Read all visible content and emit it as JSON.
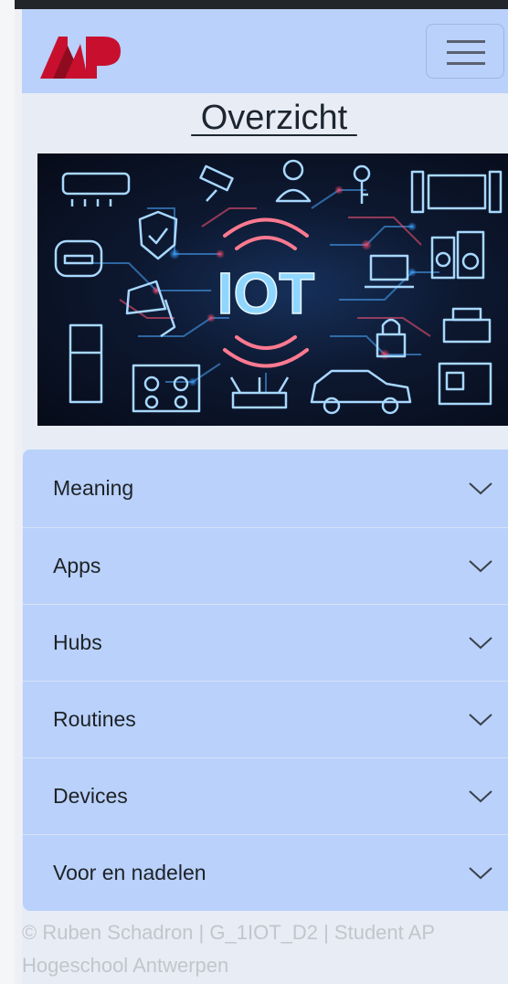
{
  "brand": {
    "logo_text": "AP",
    "logo_color": "#c8102e"
  },
  "navbar": {
    "menu_icon": "hamburger-icon",
    "background": "#b9d1fb"
  },
  "page": {
    "title": " Overzicht "
  },
  "hero": {
    "label": "IOT"
  },
  "accordion": {
    "items": [
      {
        "label": "Meaning"
      },
      {
        "label": "Apps"
      },
      {
        "label": "Hubs"
      },
      {
        "label": "Routines"
      },
      {
        "label": "Devices"
      },
      {
        "label": "Voor en nadelen"
      }
    ]
  },
  "footer": {
    "text": "© Ruben Schadron | G_1IOT_D2 | Student AP Hogeschool Antwerpen"
  }
}
